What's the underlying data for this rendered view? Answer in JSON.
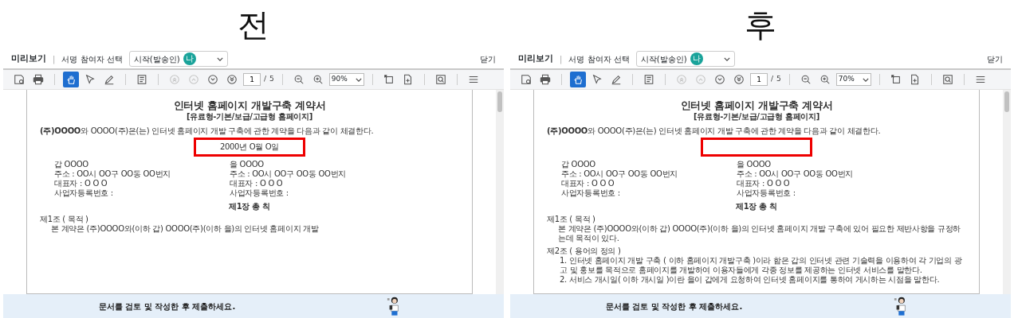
{
  "panels": [
    {
      "caption": "전",
      "header": {
        "title": "미리보기",
        "separator": "|",
        "label": "서명 참여자 선택",
        "participant": "시작(발송인)",
        "avatar": "나",
        "close": "닫기"
      },
      "toolbar": {
        "groups": [
          {
            "tools": [
              {
                "kind": "save",
                "selected": false,
                "disabled": false
              },
              {
                "kind": "print",
                "selected": false,
                "disabled": false
              }
            ]
          },
          {
            "tools": [
              {
                "kind": "hand",
                "selected": true,
                "disabled": false
              },
              {
                "kind": "pointer",
                "selected": false,
                "disabled": false
              },
              {
                "kind": "pen",
                "selected": false,
                "disabled": false
              }
            ]
          },
          {
            "tools": [
              {
                "kind": "thumbnails",
                "selected": false,
                "disabled": false
              }
            ]
          },
          {
            "tools": [
              {
                "kind": "first",
                "selected": false,
                "disabled": true
              },
              {
                "kind": "prev",
                "selected": false,
                "disabled": true
              },
              {
                "kind": "next",
                "selected": false,
                "disabled": false
              },
              {
                "kind": "last",
                "selected": false,
                "disabled": false
              },
              {
                "kind": "pager",
                "page": "1",
                "separator": "/",
                "total": "5"
              }
            ]
          },
          {
            "tools": [
              {
                "kind": "zoom-out",
                "selected": false,
                "disabled": false
              },
              {
                "kind": "zoom-in",
                "selected": false,
                "disabled": false
              },
              {
                "kind": "zoom",
                "value": "90%"
              }
            ]
          },
          {
            "tools": [
              {
                "kind": "fit",
                "selected": false,
                "disabled": false
              },
              {
                "kind": "insert",
                "selected": false,
                "disabled": false
              }
            ]
          },
          {
            "tools": [
              {
                "kind": "find",
                "selected": false,
                "disabled": false
              }
            ]
          },
          {
            "tools": [
              {
                "kind": "menu",
                "selected": false,
                "disabled": false
              }
            ]
          }
        ]
      },
      "document": {
        "lines": [
          {
            "kind": "title",
            "text": "인터넷 홈페이지 개발구축 계약서"
          },
          {
            "kind": "subtitle",
            "text": "[유료형-기본/보급/고급형 홈페이지]"
          },
          {
            "kind": "para",
            "text": "**(주)OOOO**와 OOOO(주)은(는) 인터넷 홈페이지 개발 구축에 관한 계약을 다음과 같이 체결한다."
          },
          {
            "kind": "highlight",
            "text": "2000년 O월 O일"
          },
          {
            "kind": "pair",
            "left": "갑 OOOO",
            "right": "을 OOOO"
          },
          {
            "kind": "pair",
            "left": "주소 : OO시 OO구 OO동 OO번지",
            "right": "주소 : OO시 OO구 OO동 OO번지"
          },
          {
            "kind": "pair",
            "left": "대표자 : O O O",
            "right": "대표자 : O O O"
          },
          {
            "kind": "pair",
            "left": "사업자등록번호 :",
            "right": "사업자등록번호 :"
          },
          {
            "kind": "chapter",
            "text": "제1장 총 칙"
          },
          {
            "kind": "article",
            "text": "제1조 ( 목적 )"
          },
          {
            "kind": "body",
            "text": "본 계약은 (주)OOOO와(이하 갑) OOOO(주)(이하 을)의 인터넷 홈페이지 개발"
          }
        ]
      },
      "banner": "문서를 검토 및 작성한 후 제출하세요."
    },
    {
      "caption": "후",
      "header": {
        "title": "미리보기",
        "separator": "|",
        "label": "서명 참여자 선택",
        "participant": "시작(발송인)",
        "avatar": "나",
        "close": "닫기"
      },
      "toolbar": {
        "groups": [
          {
            "tools": [
              {
                "kind": "save",
                "selected": false,
                "disabled": false
              },
              {
                "kind": "print",
                "selected": false,
                "disabled": false
              }
            ]
          },
          {
            "tools": [
              {
                "kind": "hand",
                "selected": true,
                "disabled": false
              },
              {
                "kind": "pointer",
                "selected": false,
                "disabled": false
              },
              {
                "kind": "pen",
                "selected": false,
                "disabled": false
              }
            ]
          },
          {
            "tools": [
              {
                "kind": "thumbnails",
                "selected": false,
                "disabled": false
              }
            ]
          },
          {
            "tools": [
              {
                "kind": "first",
                "selected": false,
                "disabled": true
              },
              {
                "kind": "prev",
                "selected": false,
                "disabled": true
              },
              {
                "kind": "next",
                "selected": false,
                "disabled": false
              },
              {
                "kind": "last",
                "selected": false,
                "disabled": false
              },
              {
                "kind": "pager",
                "page": "1",
                "separator": "/",
                "total": "5"
              }
            ]
          },
          {
            "tools": [
              {
                "kind": "zoom-out",
                "selected": false,
                "disabled": false
              },
              {
                "kind": "zoom-in",
                "selected": false,
                "disabled": false
              },
              {
                "kind": "zoom",
                "value": "70%"
              }
            ]
          },
          {
            "tools": [
              {
                "kind": "fit",
                "selected": false,
                "disabled": false
              },
              {
                "kind": "insert",
                "selected": false,
                "disabled": false
              }
            ]
          },
          {
            "tools": [
              {
                "kind": "find",
                "selected": false,
                "disabled": false
              }
            ]
          },
          {
            "tools": [
              {
                "kind": "menu",
                "selected": false,
                "disabled": false
              }
            ]
          }
        ]
      },
      "document": {
        "lines": [
          {
            "kind": "title",
            "text": "인터넷 홈페이지 개발구축 계약서"
          },
          {
            "kind": "subtitle",
            "text": "[유료형-기본/보급/고급형 홈페이지]"
          },
          {
            "kind": "para",
            "text": "**(주)OOOO**와 OOOO(주)은(는) 인터넷 홈페이지 개발 구축에 관한 계약을 다음과 같이 체결한다."
          },
          {
            "kind": "highlight"
          },
          {
            "kind": "pair",
            "left": "갑 OOOO",
            "right": "을 OOOO"
          },
          {
            "kind": "pair",
            "left": "주소 : OO시 OO구 OO동 OO번지",
            "right": "주소 : OO시 OO구 OO동 OO번지"
          },
          {
            "kind": "pair",
            "left": "대표자 : O O O",
            "right": "대표자 : O O O"
          },
          {
            "kind": "pair",
            "left": "사업자등록번호 :",
            "right": "사업자등록번호 :"
          },
          {
            "kind": "chapter",
            "text": "제1장 총 칙"
          },
          {
            "kind": "article",
            "text": "제1조 ( 목적 )"
          },
          {
            "kind": "body",
            "text": "본 계약은 (주)OOOO와(이하 갑) OOOO(주)(이하 을)의 인터넷 홈페이지 개발 구축에 있어 필요한 제반사항을 규정하는데 목적이 있다."
          },
          {
            "kind": "article",
            "text": "제2조 ( 용어의 정의 )"
          },
          {
            "kind": "item",
            "text": "1. 인터넷 홈페이지 개발 구축 ( 이하 홈페이지 개발구축 )이라 함은 갑의 인터넷 관련 기술력을 이용하여 각 기업의 광고 및 홍보를 목적으로 홈페이지를 개발하여 이용자들에게 각종 정보를 제공하는 인터넷 서비스를 말한다."
          },
          {
            "kind": "item",
            "text": "2. 서비스 개시일( 이하 개시일 )이란 을이 갑에게 요청하여 인터넷 홈페이지를 통하여 게시하는 시점을 말한다."
          }
        ]
      },
      "banner": "문서를 검토 및 작성한 후 제출하세요."
    }
  ]
}
